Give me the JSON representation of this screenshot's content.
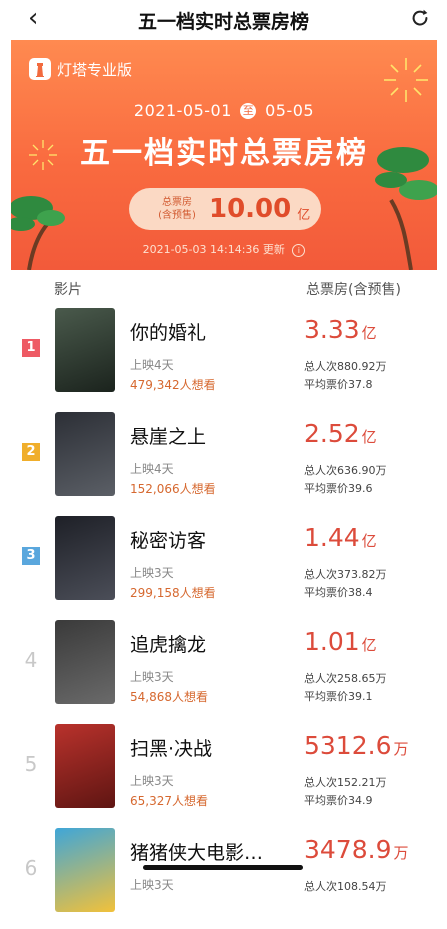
{
  "nav": {
    "title": "五一档实时总票房榜",
    "back": "‹"
  },
  "hero": {
    "brand": "灯塔专业版",
    "date_start": "2021-05-01",
    "date_sep": "至",
    "date_end": "05-05",
    "title": "五一档实时总票房榜",
    "total_label_1": "总票房",
    "total_label_2": "(含预售)",
    "total_value": "10.00",
    "total_unit": "亿",
    "updated_time": "2021-05-03 14:14:36",
    "updated_label": "更新",
    "info": "i",
    "colors": {
      "top": "#ff8a50",
      "bottom": "#f25a3a",
      "tree": "#2f8a3f",
      "spark": "#ffe36b"
    }
  },
  "list": {
    "col_movie": "影片",
    "col_gross": "总票房(含预售)",
    "rows": [
      {
        "rank": "1",
        "name": "你的婚礼",
        "days": "上映4天",
        "want": "479,342人想看",
        "gross": "3.33",
        "unit": "亿",
        "persons": "总人次880.92万",
        "price": "平均票价37.8",
        "badge_color": "#ee5a64",
        "poster_a": "#4a5a4c",
        "poster_b": "#1b231d"
      },
      {
        "rank": "2",
        "name": "悬崖之上",
        "days": "上映4天",
        "want": "152,066人想看",
        "gross": "2.52",
        "unit": "亿",
        "persons": "总人次636.90万",
        "price": "平均票价39.6",
        "badge_color": "#f0ae2b",
        "poster_a": "#2c2f36",
        "poster_b": "#5b5f66"
      },
      {
        "rank": "3",
        "name": "秘密访客",
        "days": "上映3天",
        "want": "299,158人想看",
        "gross": "1.44",
        "unit": "亿",
        "persons": "总人次373.82万",
        "price": "平均票价38.4",
        "badge_color": "#5aa7dd",
        "poster_a": "#1e2027",
        "poster_b": "#4b4e58"
      },
      {
        "rank": "4",
        "name": "追虎擒龙",
        "days": "上映3天",
        "want": "54,868人想看",
        "gross": "1.01",
        "unit": "亿",
        "persons": "总人次258.65万",
        "price": "平均票价39.1",
        "badge_color": "",
        "poster_a": "#3a3a3a",
        "poster_b": "#6a6a6a"
      },
      {
        "rank": "5",
        "name": "扫黑·决战",
        "days": "上映3天",
        "want": "65,327人想看",
        "gross": "5312.6",
        "unit": "万",
        "persons": "总人次152.21万",
        "price": "平均票价34.9",
        "badge_color": "",
        "poster_a": "#b9322c",
        "poster_b": "#5e1512"
      },
      {
        "rank": "6",
        "name": "猪猪侠大电影…",
        "days": "上映3天",
        "want": "",
        "gross": "3478.9",
        "unit": "万",
        "persons": "总人次108.54万",
        "price": "",
        "badge_color": "",
        "poster_a": "#3fa6d8",
        "poster_b": "#f2c13a"
      }
    ]
  }
}
